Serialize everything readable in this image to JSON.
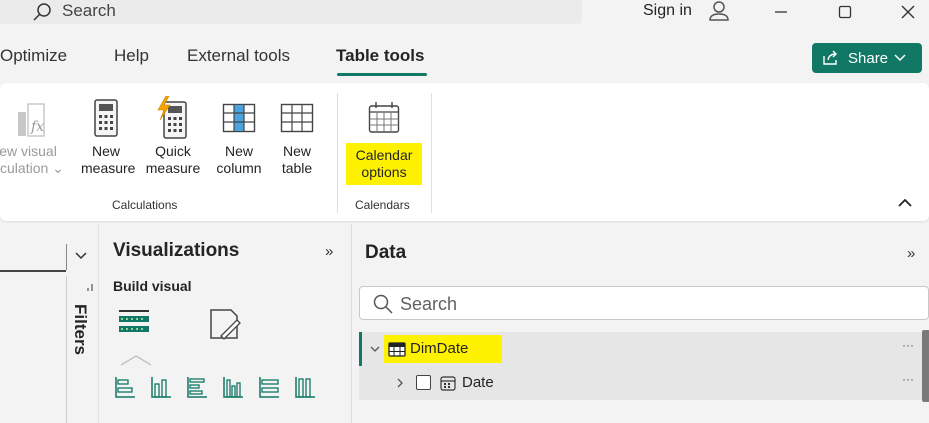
{
  "titlebar": {
    "search_placeholder": "Search",
    "sign_in": "Sign in",
    "controls": [
      "—",
      "☐",
      "✕"
    ]
  },
  "menu": {
    "tabs": [
      "Optimize",
      "Help",
      "External tools",
      "Table tools"
    ],
    "active_tab": "Table tools",
    "share_label": "Share",
    "accent": "#117865"
  },
  "ribbon": {
    "items": [
      {
        "label_1": "New visual",
        "label_2": "calculation"
      },
      {
        "label_1": "New",
        "label_2": "measure"
      },
      {
        "label_1": "Quick",
        "label_2": "measure"
      },
      {
        "label_1": "New",
        "label_2": "column"
      },
      {
        "label_1": "New",
        "label_2": "table"
      },
      {
        "label_1": "Calendar",
        "label_2": "options"
      }
    ],
    "groups": {
      "calculations": "Calculations",
      "calendars": "Calendars"
    },
    "highlight_color": "#fff200"
  },
  "filters": {
    "label": "Filters"
  },
  "visualizations": {
    "title": "Visualizations",
    "expand": "»",
    "build_visual": "Build visual"
  },
  "data": {
    "title": "Data",
    "expand": "»",
    "search_placeholder": "Search",
    "tree": [
      {
        "label": "DimDate",
        "expanded": true,
        "type": "table"
      },
      {
        "label": "Date",
        "expanded": false,
        "type": "date-hierarchy"
      }
    ],
    "more": "···"
  }
}
